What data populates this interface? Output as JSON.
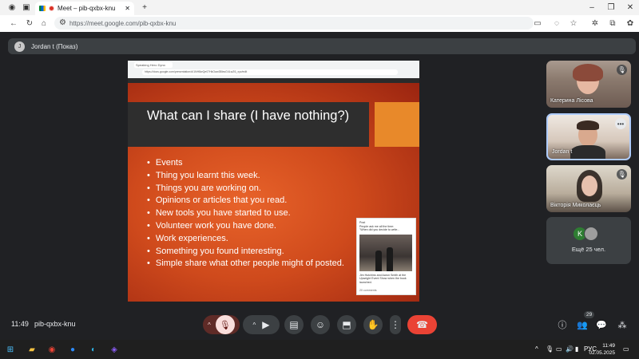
{
  "browser": {
    "tab_title": "Meet – pib-qxbx-knu",
    "new_tab": "+",
    "url": "https://meet.google.com/pib-qxbx-knu"
  },
  "presenter": {
    "label": "Jordan t (Показ)",
    "avatar_letter": "J"
  },
  "shared_screen": {
    "mini_tab": "Speaking Hero Dyno",
    "mini_url": "https://docs.google.com/presentation/d/1NH8wQe07HkOaw3BlxsG4LwZ6_xyz/edit",
    "slide": {
      "title": "What can I share (I have nothing?)",
      "bullets": [
        "Events",
        "Thing you learnt this week.",
        "Things you are working on.",
        "Opinions or articles that you read.",
        "New tools you have started to use.",
        "Volunteer work you have done.",
        "Work experiences.",
        "Something you found interesting.",
        "Simple share what other people might of posted."
      ],
      "image_post": {
        "header": "Post",
        "line1": "People ask me all the time:",
        "line2": "\"When did you decide to write...",
        "caption": "Jim Hutchins and Aaron Smith at the Upwright Event Show when the book launched.",
        "footer": "20 comments"
      }
    }
  },
  "participants": [
    {
      "name": "Катерина Лісова",
      "muted": true
    },
    {
      "name": "Jordan t",
      "speaking": true
    },
    {
      "name": "Вікторія Миколаєць",
      "muted": true
    }
  ],
  "more_participants": {
    "label": "Ещё 25 чел.",
    "avatar_letter": "K",
    "avatar_color": "#2e7d32"
  },
  "bottom_bar": {
    "time": "11:49",
    "meeting_code": "pib-qxbx-knu",
    "people_count": "29"
  },
  "taskbar": {
    "language": "РУС",
    "time": "11:49",
    "date": "02.05.2025"
  },
  "colors": {
    "meet_bg": "#202124",
    "end_call": "#ea4335",
    "slide_orange": "#e8892a"
  }
}
